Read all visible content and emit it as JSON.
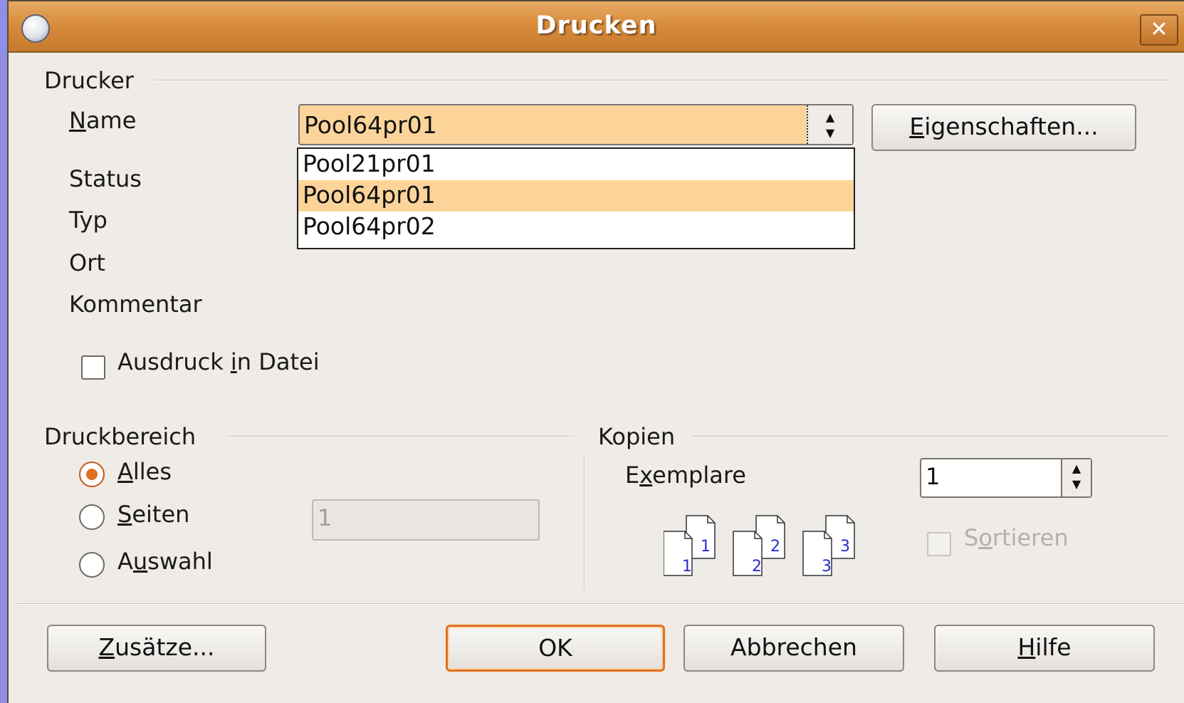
{
  "window": {
    "title": "Drucken",
    "close_label": "✕"
  },
  "printer": {
    "group_label": "Drucker",
    "name_label": "Name",
    "status_label": "Status",
    "type_label": "Typ",
    "location_label": "Ort",
    "comment_label": "Kommentar",
    "selected": "Pool64pr01",
    "options": [
      "Pool21pr01",
      "Pool64pr01",
      "Pool64pr02"
    ],
    "properties_button": "Eigenschaften...",
    "print_to_file_label": "Ausdruck in Datei",
    "print_to_file_checked": false
  },
  "range": {
    "group_label": "Druckbereich",
    "all_label": "Alles",
    "pages_label": "Seiten",
    "selection_label": "Auswahl",
    "selected_option": "Alles",
    "pages_value": "1"
  },
  "copies": {
    "group_label": "Kopien",
    "count_label": "Exemplare",
    "count_value": "1",
    "collate_label": "Sortieren",
    "collate_checked": false,
    "collate_icon_numbers": [
      "1",
      "1",
      "2",
      "2",
      "3",
      "3"
    ]
  },
  "buttons": {
    "options": "Zusätze...",
    "ok": "OK",
    "cancel": "Abbrechen",
    "help": "Hilfe"
  },
  "colors": {
    "accent": "#e0701e",
    "titlebar": "#d98c3c",
    "selection": "#fcd49a",
    "background": "#efebe7"
  }
}
